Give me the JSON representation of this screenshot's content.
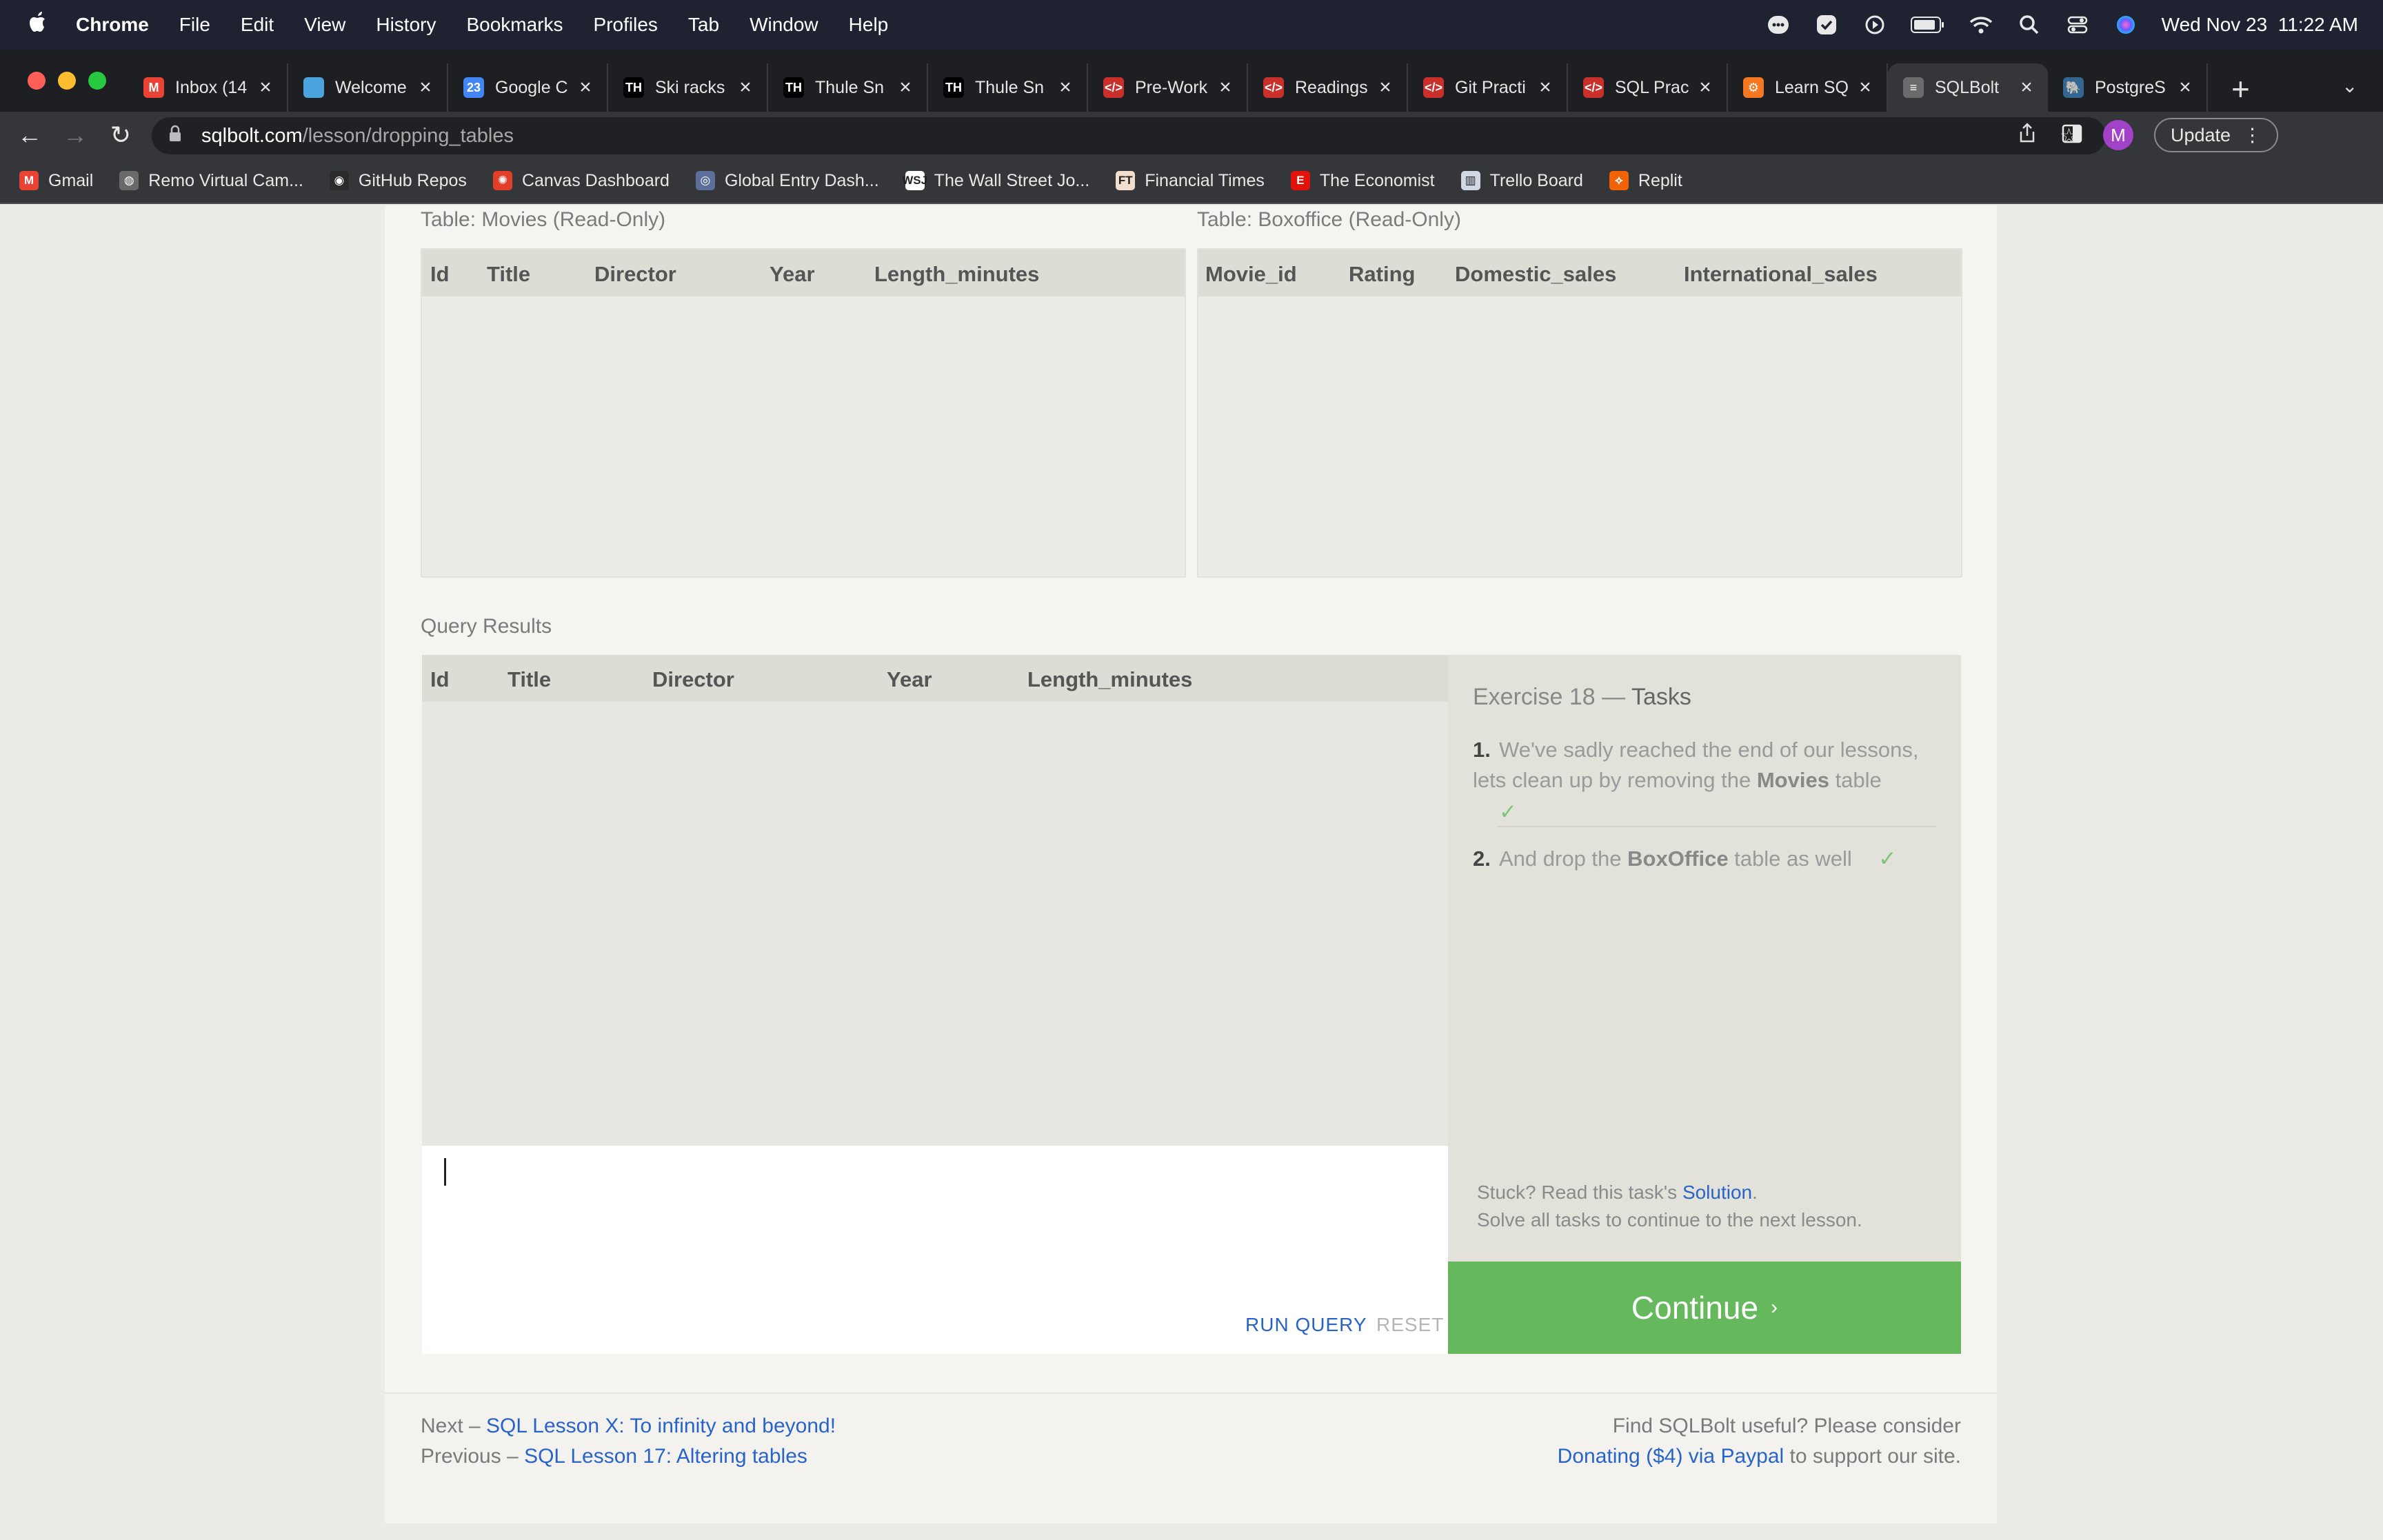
{
  "menubar": {
    "app": "Chrome",
    "items": [
      "File",
      "Edit",
      "View",
      "History",
      "Bookmarks",
      "Profiles",
      "Tab",
      "Window",
      "Help"
    ],
    "datetime": "Wed Nov 23  11:22 AM"
  },
  "tabs": [
    {
      "title": "Inbox (14",
      "icon": "gmail-icon",
      "color": "#ea4335",
      "glyph": "M"
    },
    {
      "title": "Welcome",
      "icon": "welcome-icon",
      "color": "#4aa3df",
      "glyph": ""
    },
    {
      "title": "Google C",
      "icon": "google-calendar-icon",
      "color": "#4285f4",
      "glyph": "23"
    },
    {
      "title": "Ski racks",
      "icon": "thule-icon",
      "color": "#000000",
      "glyph": "TH"
    },
    {
      "title": "Thule Sn",
      "icon": "thule-icon",
      "color": "#000000",
      "glyph": "TH"
    },
    {
      "title": "Thule Sn",
      "icon": "thule-icon",
      "color": "#000000",
      "glyph": "TH"
    },
    {
      "title": "Pre-Work",
      "icon": "code-shield-icon",
      "color": "#c9302c",
      "glyph": "</>"
    },
    {
      "title": "Readings",
      "icon": "code-shield-icon",
      "color": "#c9302c",
      "glyph": "</>"
    },
    {
      "title": "Git Practi",
      "icon": "code-shield-icon",
      "color": "#c9302c",
      "glyph": "</>"
    },
    {
      "title": "SQL Prac",
      "icon": "code-shield-icon",
      "color": "#c9302c",
      "glyph": "</>"
    },
    {
      "title": "Learn SQ",
      "icon": "hubspot-icon",
      "color": "#f57722",
      "glyph": "⚙"
    },
    {
      "title": "SQLBolt",
      "icon": "database-icon",
      "color": "#6b6b6b",
      "glyph": "≡",
      "active": true
    },
    {
      "title": "PostgreS",
      "icon": "postgres-icon",
      "color": "#336791",
      "glyph": "🐘"
    }
  ],
  "toolbar": {
    "url_host": "sqlbolt.com",
    "url_path": "/lesson/dropping_tables",
    "avatar_letter": "M",
    "update_label": "Update"
  },
  "bookmarks": [
    {
      "label": "Gmail",
      "icon": "gmail-icon",
      "color": "#ea4335",
      "glyph": "M"
    },
    {
      "label": "Remo Virtual Cam...",
      "icon": "globe-icon",
      "color": "#6a6a6a",
      "glyph": "◍"
    },
    {
      "label": "GitHub Repos",
      "icon": "github-icon",
      "color": "#2b2b2b",
      "glyph": "◉"
    },
    {
      "label": "Canvas Dashboard",
      "icon": "canvas-icon",
      "color": "#e13f29",
      "glyph": "✺"
    },
    {
      "label": "Global Entry Dash...",
      "icon": "dhs-seal-icon",
      "color": "#5b6f9a",
      "glyph": "◎"
    },
    {
      "label": "The Wall Street Jo...",
      "icon": "wsj-icon",
      "color": "#ffffff",
      "glyph": "WSJ"
    },
    {
      "label": "Financial Times",
      "icon": "ft-icon",
      "color": "#f2dfce",
      "glyph": "FT"
    },
    {
      "label": "The Economist",
      "icon": "economist-icon",
      "color": "#e3120b",
      "glyph": "E"
    },
    {
      "label": "Trello Board",
      "icon": "trello-icon",
      "color": "#cfd8e3",
      "glyph": "▥"
    },
    {
      "label": "Replit",
      "icon": "replit-icon",
      "color": "#f26207",
      "glyph": "⟡"
    }
  ],
  "page": {
    "movies_table": {
      "label": "Table: Movies (Read-Only)",
      "columns": [
        "Id",
        "Title",
        "Director",
        "Year",
        "Length_minutes"
      ]
    },
    "boxoffice_table": {
      "label": "Table: Boxoffice (Read-Only)",
      "columns": [
        "Movie_id",
        "Rating",
        "Domestic_sales",
        "International_sales"
      ]
    },
    "results": {
      "label": "Query Results",
      "columns": [
        "Id",
        "Title",
        "Director",
        "Year",
        "Length_minutes"
      ]
    },
    "editor": {
      "query": "",
      "run_label": "RUN QUERY",
      "reset_label": "RESET"
    },
    "tasks": {
      "heading_prefix": "Exercise 18 —",
      "heading_strong": "Tasks",
      "items": [
        {
          "num": "1.",
          "pre": "We've sadly reached the end of our lessons, lets clean up by removing the ",
          "bold": "Movies",
          "post": " table",
          "check": "✓"
        },
        {
          "num": "2.",
          "pre": "And drop the ",
          "bold": "BoxOffice",
          "post": " table as well",
          "check": "✓"
        }
      ],
      "stuck_prefix": "Stuck? Read this task's ",
      "stuck_link": "Solution",
      "stuck_suffix": ".",
      "solve_all": "Solve all tasks to continue to the next lesson."
    },
    "continue_label": "Continue",
    "continue_arrow": "›",
    "footer": {
      "next_prefix": "Next – ",
      "next_link": "SQL Lesson X: To infinity and beyond!",
      "prev_prefix": "Previous – ",
      "prev_link": "SQL Lesson 17: Altering tables",
      "support_line1": "Find SQLBolt useful? Please consider",
      "support_link": "Donating ($4) via Paypal",
      "support_suffix": " to support our site."
    }
  },
  "colors": {
    "continue_green": "#65b85c",
    "link_blue": "#2864c8",
    "check_green": "#7cc47a"
  }
}
